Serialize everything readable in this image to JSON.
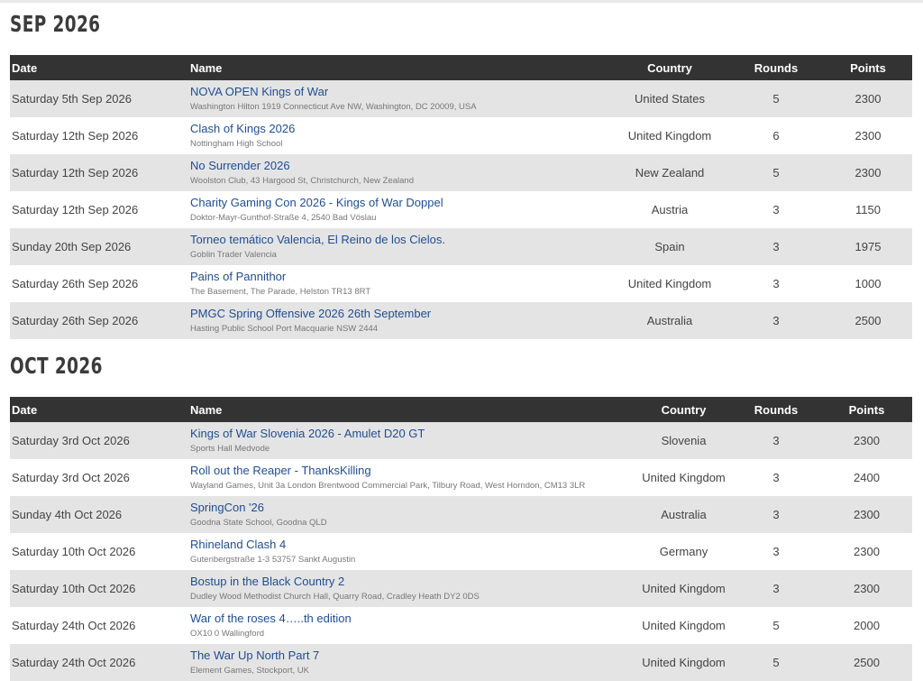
{
  "sections": [
    {
      "title": "SEP 2026",
      "headers": {
        "date": "Date",
        "name": "Name",
        "country": "Country",
        "rounds": "Rounds",
        "points": "Points"
      },
      "rows": [
        {
          "date": "Saturday 5th Sep 2026",
          "name": "NOVA OPEN Kings of War",
          "venue": "Washington Hilton 1919 Connecticut Ave NW, Washington, DC 20009, USA",
          "country": "United States",
          "rounds": "5",
          "points": "2300"
        },
        {
          "date": "Saturday 12th Sep 2026",
          "name": "Clash of Kings 2026",
          "venue": "Nottingham High School",
          "country": "United Kingdom",
          "rounds": "6",
          "points": "2300"
        },
        {
          "date": "Saturday 12th Sep 2026",
          "name": "No Surrender 2026",
          "venue": "Woolston Club, 43 Hargood St, Christchurch, New Zealand",
          "country": "New Zealand",
          "rounds": "5",
          "points": "2300"
        },
        {
          "date": "Saturday 12th Sep 2026",
          "name": "Charity Gaming Con 2026 - Kings of War Doppel",
          "venue": "Doktor-Mayr-Gunthof-Straße 4, 2540 Bad Vöslau",
          "country": "Austria",
          "rounds": "3",
          "points": "1150"
        },
        {
          "date": "Sunday 20th Sep 2026",
          "name": "Torneo temático Valencia, El Reino de los Cielos.",
          "venue": "Goblin Trader Valencia",
          "country": "Spain",
          "rounds": "3",
          "points": "1975"
        },
        {
          "date": "Saturday 26th Sep 2026",
          "name": "Pains of Pannithor",
          "venue": "The Basement, The Parade, Helston TR13 8RT",
          "country": "United Kingdom",
          "rounds": "3",
          "points": "1000"
        },
        {
          "date": "Saturday 26th Sep 2026",
          "name": "PMGC Spring Offensive 2026 26th September",
          "venue": "Hasting Public School Port Macquarie NSW 2444",
          "country": "Australia",
          "rounds": "3",
          "points": "2500"
        }
      ]
    },
    {
      "title": "OCT 2026",
      "headers": {
        "date": "Date",
        "name": "Name",
        "country": "Country",
        "rounds": "Rounds",
        "points": "Points"
      },
      "rows": [
        {
          "date": "Saturday 3rd Oct 2026",
          "name": "Kings of War Slovenia 2026 - Amulet D20 GT",
          "venue": "Sports Hall Medvode",
          "country": "Slovenia",
          "rounds": "3",
          "points": "2300"
        },
        {
          "date": "Saturday 3rd Oct 2026",
          "name": "Roll out the Reaper - ThanksKilling",
          "venue": "Wayland Games, Unit 3a London Brentwood Commercial Park, Tilbury Road, West Horndon, CM13 3LR",
          "country": "United Kingdom",
          "rounds": "3",
          "points": "2400"
        },
        {
          "date": "Sunday 4th Oct 2026",
          "name": "SpringCon '26",
          "venue": "Goodna State School, Goodna QLD",
          "country": "Australia",
          "rounds": "3",
          "points": "2300"
        },
        {
          "date": "Saturday 10th Oct 2026",
          "name": "Rhineland Clash 4",
          "venue": "Gutenbergstraße 1-3 53757 Sankt Augustin",
          "country": "Germany",
          "rounds": "3",
          "points": "2300"
        },
        {
          "date": "Saturday 10th Oct 2026",
          "name": "Bostup in the Black Country 2",
          "venue": "Dudley Wood Methodist Church Hall, Quarry Road, Cradley Heath DY2 0DS",
          "country": "United Kingdom",
          "rounds": "3",
          "points": "2300"
        },
        {
          "date": "Saturday 24th Oct 2026",
          "name": "War of the roses 4…..th edition",
          "venue": "OX10 0 Wallingford",
          "country": "United Kingdom",
          "rounds": "5",
          "points": "2000"
        },
        {
          "date": "Saturday 24th Oct 2026",
          "name": "The War Up North Part 7",
          "venue": "Element Games, Stockport, UK",
          "country": "United Kingdom",
          "rounds": "5",
          "points": "2500"
        }
      ]
    }
  ]
}
